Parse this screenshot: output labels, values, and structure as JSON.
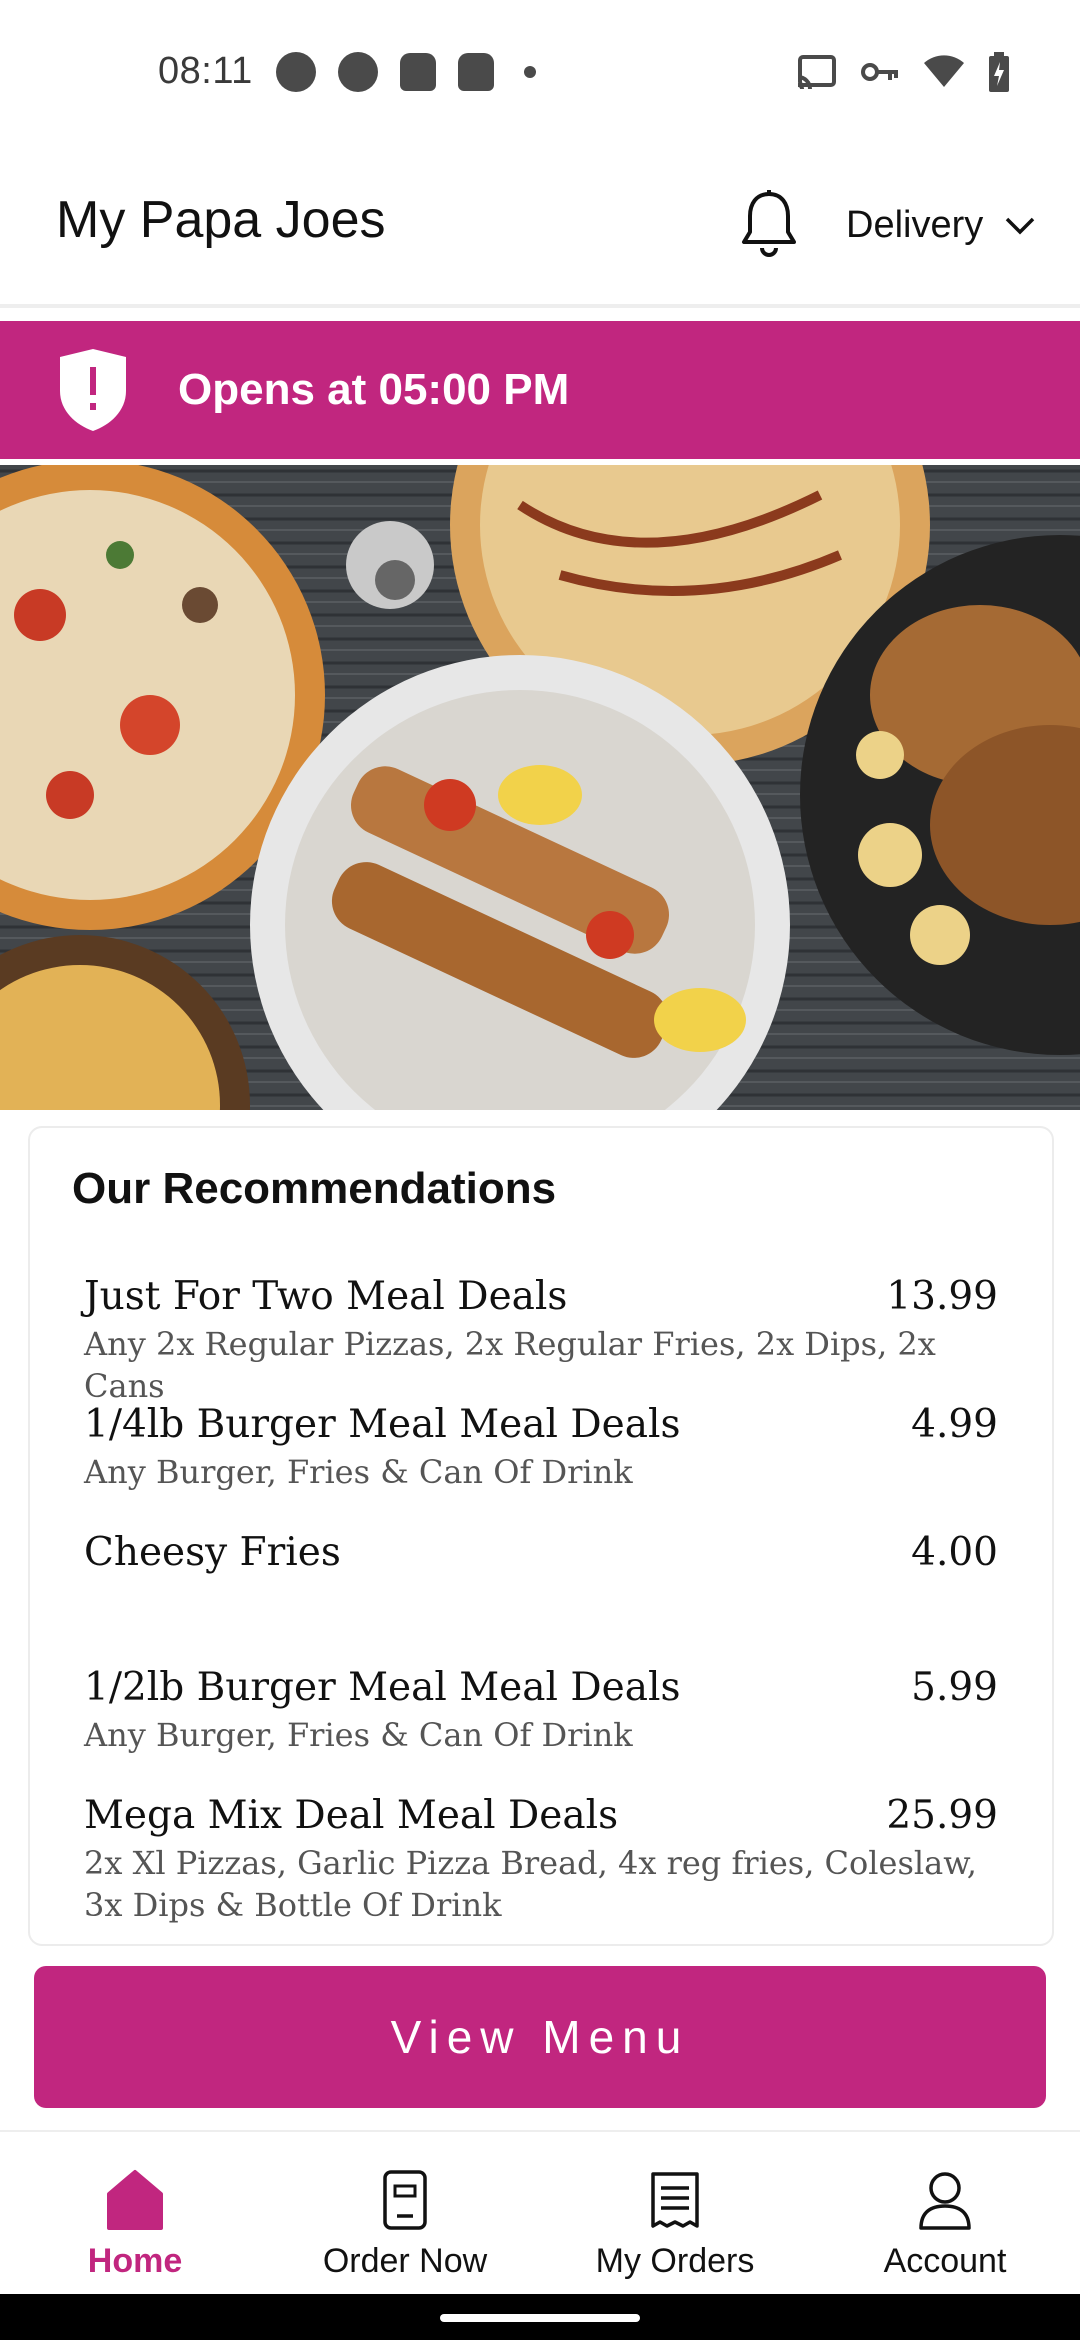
{
  "status_bar": {
    "time": "08:11",
    "left_icons": [
      "pocket-casts-icon",
      "sync-icon",
      "android-icon",
      "android-icon",
      "notification-dot-icon"
    ],
    "right_icons": [
      "cast-icon",
      "vpn-key-icon",
      "wifi-icon",
      "battery-icon"
    ]
  },
  "app_bar": {
    "title": "My Papa Joes",
    "delivery_label": "Delivery"
  },
  "banner": {
    "text": "Opens at 05:00 PM",
    "color": "#c1267f"
  },
  "hero": {
    "icon": "food-photo"
  },
  "recommendations": {
    "title": "Our Recommendations",
    "items": [
      {
        "name": "Just For Two Meal Deals",
        "price": "13.99",
        "description": "Any 2x Regular Pizzas, 2x Regular Fries, 2x Dips, 2x Cans"
      },
      {
        "name": "1/4lb Burger Meal Meal Deals",
        "price": "4.99",
        "description": "Any Burger, Fries & Can Of Drink"
      },
      {
        "name": "Cheesy Fries",
        "price": "4.00",
        "description": ""
      },
      {
        "name": "1/2lb Burger Meal Meal Deals",
        "price": "5.99",
        "description": "Any Burger, Fries & Can Of Drink"
      },
      {
        "name": "Mega Mix Deal Meal Deals",
        "price": "25.99",
        "description": "2x Xl Pizzas, Garlic Pizza Bread, 4x reg fries, Coleslaw, 3x Dips & Bottle Of Drink"
      }
    ]
  },
  "view_menu_label": "View Menu",
  "bottom_nav": {
    "items": [
      {
        "label": "Home",
        "icon": "home-icon",
        "active": true
      },
      {
        "label": "Order Now",
        "icon": "order-icon",
        "active": false
      },
      {
        "label": "My Orders",
        "icon": "receipt-icon",
        "active": false
      },
      {
        "label": "Account",
        "icon": "user-icon",
        "active": false
      }
    ]
  },
  "colors": {
    "accent": "#c1267f"
  }
}
